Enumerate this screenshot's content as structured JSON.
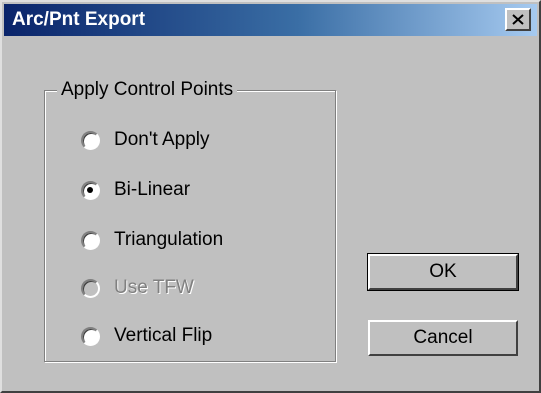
{
  "window": {
    "title": "Arc/Pnt Export",
    "close_glyph": "✕",
    "titlebar_colors": [
      "#0a246a",
      "#a6caf0"
    ],
    "face_color": "#c0c0c0"
  },
  "group": {
    "label": "Apply Control Points",
    "options": [
      {
        "label": "Don't Apply",
        "checked": false,
        "disabled": false
      },
      {
        "label": "Bi-Linear",
        "checked": true,
        "disabled": false
      },
      {
        "label": "Triangulation",
        "checked": false,
        "disabled": false
      },
      {
        "label": "Use TFW",
        "checked": false,
        "disabled": true
      },
      {
        "label": "Vertical Flip",
        "checked": false,
        "disabled": false
      }
    ]
  },
  "buttons": {
    "ok_label": "OK",
    "cancel_label": "Cancel"
  }
}
